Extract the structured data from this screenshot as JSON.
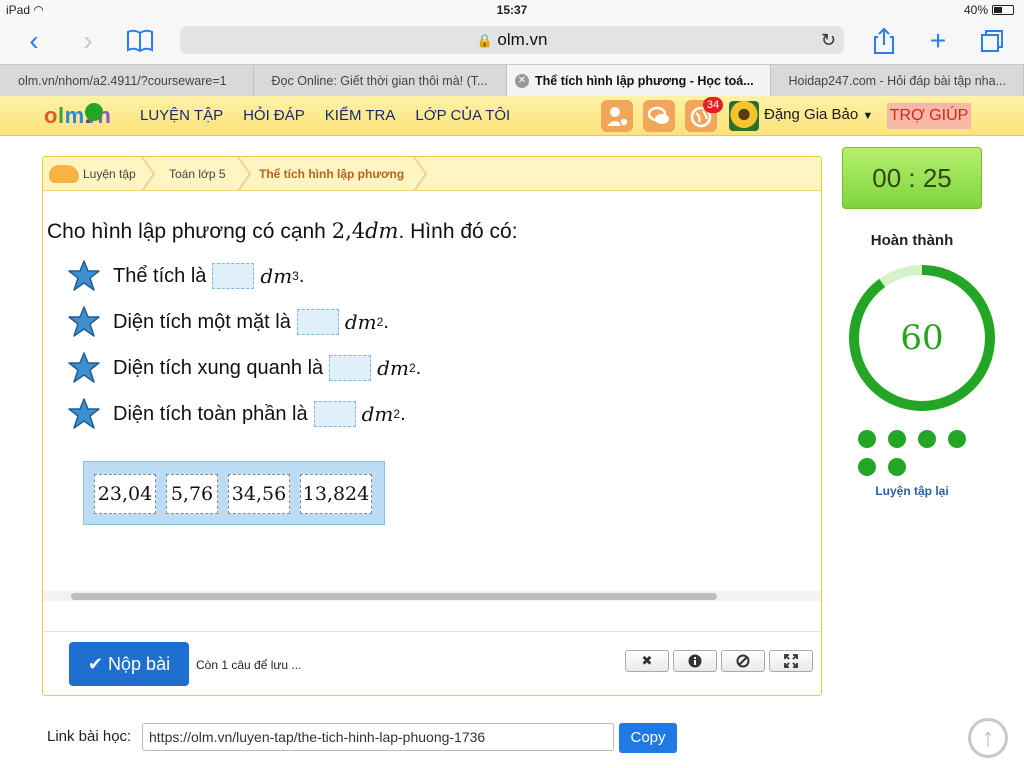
{
  "status_bar": {
    "device": "iPad",
    "time": "15:37",
    "battery": "40%"
  },
  "browser": {
    "url": "olm.vn",
    "tabs": [
      {
        "label": "olm.vn/nhom/a2.4911/?courseware=1"
      },
      {
        "label": "Đọc Online: Giết thời gian thôi mà! (T..."
      },
      {
        "label": "Thể tích hình lập phương - Học toá..."
      },
      {
        "label": "Hoidap247.com - Hỏi đáp bài tập nha..."
      }
    ]
  },
  "site": {
    "logo": {
      "o": "o",
      "l": "l",
      "m": "m",
      "dot": ".",
      "vn": "vn"
    },
    "nav": [
      "LUYỆN TẬP",
      "HỎI ĐÁP",
      "KIỂM TRA",
      "LỚP CỦA TÔI"
    ],
    "notification_count": "34",
    "username": "Đặng Gia Bảo",
    "help_label": "TRỢ GIÚP"
  },
  "breadcrumb": [
    "Luyện tập",
    "Toán lớp 5",
    "Thể tích hình lập phương"
  ],
  "question": {
    "prefix": "Cho hình lập phương có cạnh",
    "edge": "2,4",
    "edge_unit": "dm",
    "suffix": ". Hình đó có:",
    "items": [
      {
        "label": "Thể tích là",
        "unit": "dm",
        "power": "3"
      },
      {
        "label": "Diện tích một mặt là",
        "unit": "dm",
        "power": "2"
      },
      {
        "label": "Diện tích xung quanh là",
        "unit": "dm",
        "power": "2"
      },
      {
        "label": "Diện tích toàn phần là",
        "unit": "dm",
        "power": "2"
      }
    ],
    "choices": [
      "23,04",
      "5,76",
      "34,56",
      "13,824"
    ]
  },
  "footer": {
    "submit_label": "Nộp bài",
    "remaining_text": "Còn 1 câu để lưu ..."
  },
  "sidebar": {
    "timer": "00 : 25",
    "completed_label": "Hoàn thành",
    "score": "60",
    "progress_fraction": 0.9,
    "question_dots_filled": 6,
    "retry_label": "Luyện tập lại"
  },
  "link_row": {
    "label": "Link bài học:",
    "url": "https://olm.vn/luyen-tap/the-tich-hinh-lap-phuong-1736",
    "copy_label": "Copy"
  },
  "colors": {
    "accent_green": "#25a525",
    "submit_blue": "#1f6fd1",
    "header_yellow": "#fbe27a"
  }
}
